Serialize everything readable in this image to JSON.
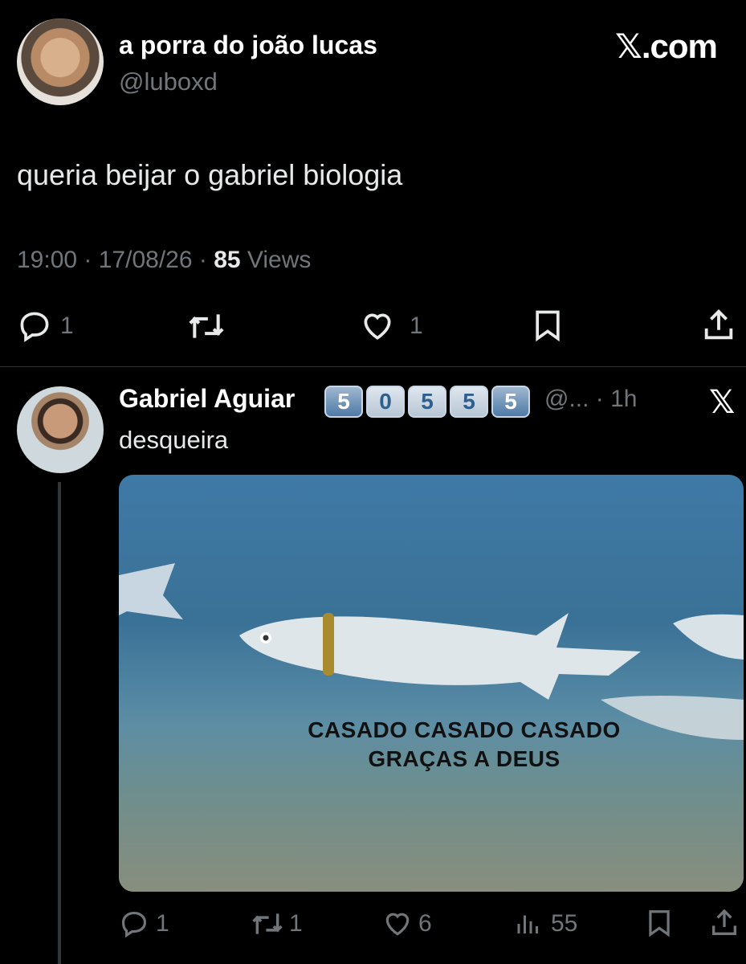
{
  "main_tweet": {
    "display_name": "a porra do joão lucas",
    "handle": "@luboxd",
    "brand": "𝕏.com",
    "text": "queria beijar o gabriel biologia",
    "time": "19:00",
    "date": "17/08/26",
    "views_count": "85",
    "views_label": " Views",
    "actions": {
      "replies": "1",
      "likes": "1"
    }
  },
  "reply": {
    "display_name": "Gabriel Aguiar",
    "badges": [
      "5",
      "0",
      "5",
      "5",
      "5"
    ],
    "handle_time": "@... · 1h",
    "brand_icon": "𝕏",
    "text": "desqueira",
    "image_caption_line1": "CASADO CASADO CASADO",
    "image_caption_line2": "GRAÇAS A DEUS",
    "actions": {
      "replies": "1",
      "retweets": "1",
      "likes": "6",
      "views": "55"
    }
  },
  "icons": [
    "reply-icon",
    "retweet-icon",
    "like-icon",
    "bookmark-icon",
    "share-icon",
    "views-icon"
  ]
}
